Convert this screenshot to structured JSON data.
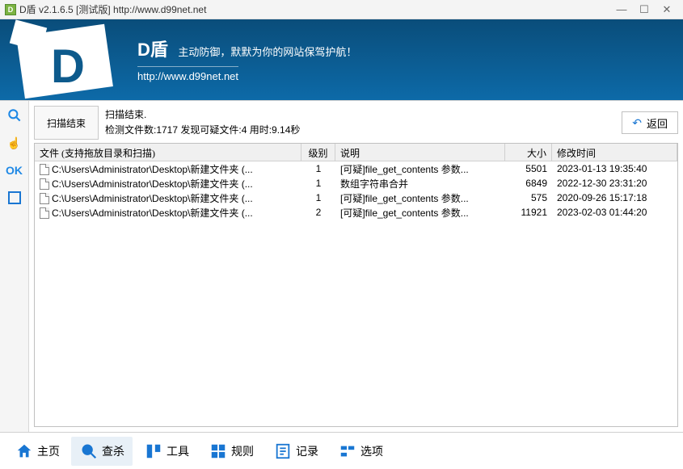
{
  "window": {
    "title": "D盾 v2.1.6.5 [测试版] http://www.d99net.net"
  },
  "banner": {
    "brand": "D盾",
    "slogan": "主动防御，默默为你的网站保驾护航！",
    "url": "http://www.d99net.net"
  },
  "sidebar": {
    "ok_label": "OK"
  },
  "scan": {
    "end_button": "扫描结束",
    "status_line1": "扫描结束.",
    "status_line2": "检测文件数:1717 发现可疑文件:4 用时:9.14秒",
    "back_button": "返回"
  },
  "table": {
    "headers": {
      "file": "文件 (支持拖放目录和扫描)",
      "level": "级别",
      "desc": "说明",
      "size": "大小",
      "time": "修改时间"
    },
    "rows": [
      {
        "file": "C:\\Users\\Administrator\\Desktop\\新建文件夹 (...",
        "level": "1",
        "desc": "[可疑]file_get_contents 参数...",
        "size": "5501",
        "time": "2023-01-13 19:35:40"
      },
      {
        "file": "C:\\Users\\Administrator\\Desktop\\新建文件夹 (...",
        "level": "1",
        "desc": "数组字符串合并",
        "size": "6849",
        "time": "2022-12-30 23:31:20"
      },
      {
        "file": "C:\\Users\\Administrator\\Desktop\\新建文件夹 (...",
        "level": "1",
        "desc": "[可疑]file_get_contents 参数...",
        "size": "575",
        "time": "2020-09-26 15:17:18"
      },
      {
        "file": "C:\\Users\\Administrator\\Desktop\\新建文件夹 (...",
        "level": "2",
        "desc": "[可疑]file_get_contents 参数...",
        "size": "11921",
        "time": "2023-02-03 01:44:20"
      }
    ]
  },
  "nav": {
    "home": "主页",
    "scan": "查杀",
    "tools": "工具",
    "rules": "规则",
    "log": "记录",
    "options": "选项"
  }
}
